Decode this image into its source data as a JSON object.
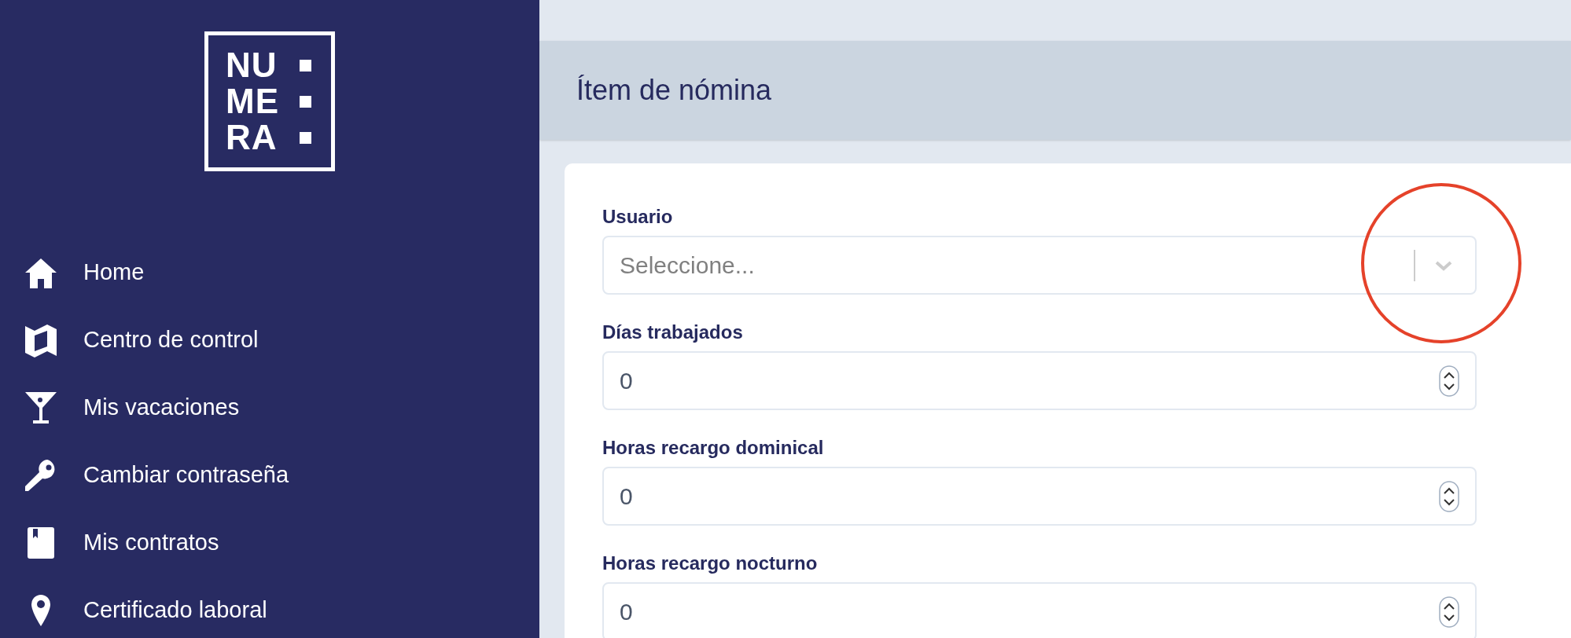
{
  "logo": {
    "lines": [
      "NU",
      "ME",
      "RA"
    ]
  },
  "sidebar": {
    "items": [
      {
        "label": "Home",
        "kind": "home"
      },
      {
        "label": "Centro de control",
        "kind": "map"
      },
      {
        "label": "Mis vacaciones",
        "kind": "cocktail"
      },
      {
        "label": "Cambiar contraseña",
        "kind": "key"
      },
      {
        "label": "Mis contratos",
        "kind": "book"
      },
      {
        "label": "Certificado laboral",
        "kind": "pin"
      }
    ]
  },
  "page": {
    "title": "Ítem de nómina"
  },
  "form": {
    "fields": [
      {
        "kind": "select",
        "label": "Usuario",
        "placeholder": "Seleccione..."
      },
      {
        "kind": "number",
        "label": "Días trabajados",
        "value": "0"
      },
      {
        "kind": "number",
        "label": "Horas recargo dominical",
        "value": "0"
      },
      {
        "kind": "number",
        "label": "Horas recargo nocturno",
        "value": "0"
      }
    ]
  },
  "annotation": {
    "kind": "circle"
  }
}
